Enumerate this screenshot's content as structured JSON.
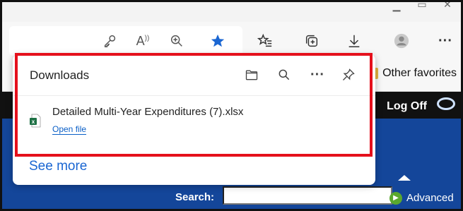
{
  "toolbar": {
    "icons": [
      "key-icon",
      "read-aloud-icon",
      "zoom-in-icon",
      "favorite-star-icon",
      "favorites-icon",
      "collections-icon",
      "downloads-icon",
      "profile-icon",
      "more-icon"
    ],
    "read_aloud_glyph": "Ă̩",
    "more_glyph": "···",
    "accent": "#1a66d2"
  },
  "bookmarks_bar": {
    "other_favorites": "Other favorites"
  },
  "downloads": {
    "title": "Downloads",
    "more_glyph": "···",
    "items": [
      {
        "file_name": "Detailed Multi-Year Expenditures (7).xlsx",
        "action": "Open file",
        "type_icon": "excel-file-icon"
      }
    ],
    "see_more": "See more",
    "highlight_color": "#e5101c"
  },
  "page": {
    "log_off": "Log Off",
    "search_label": "Search:",
    "search_value": "",
    "advanced": "Advanced"
  }
}
